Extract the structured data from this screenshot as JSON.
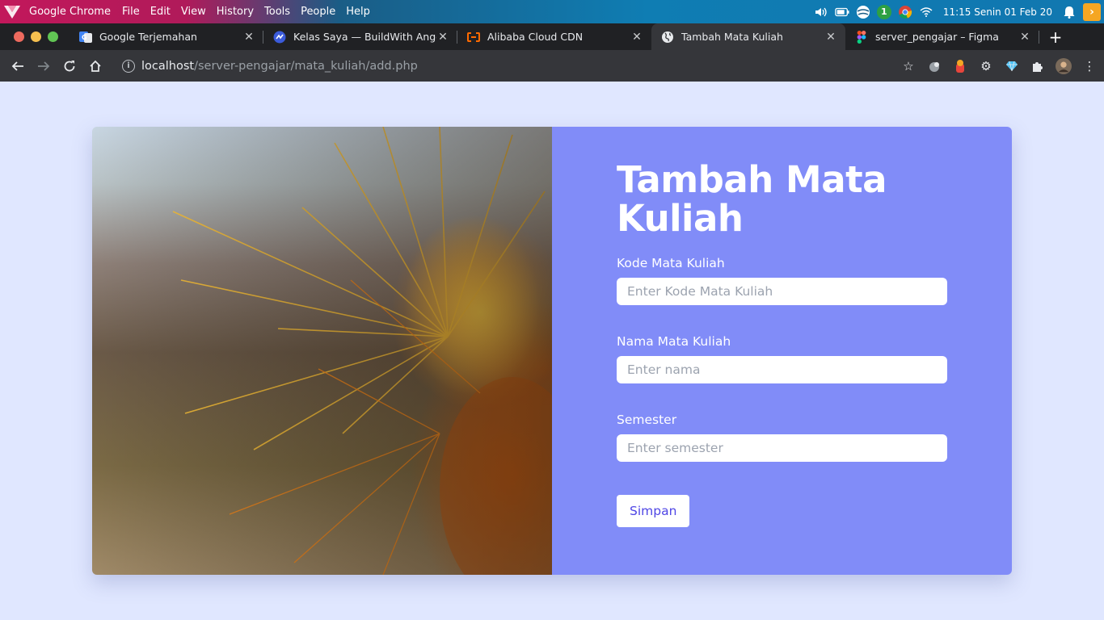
{
  "os": {
    "app_name": "Google Chrome",
    "menus": [
      "File",
      "Edit",
      "View",
      "History",
      "Tools",
      "People",
      "Help"
    ],
    "clock": "11:15 Senin 01 Feb 20",
    "badge_count": "1"
  },
  "tabs": [
    {
      "title": "Google Terjemahan",
      "icon": "google-translate-icon",
      "active": false
    },
    {
      "title": "Kelas Saya — BuildWith Angga",
      "icon": "buildwithangga-icon",
      "active": false
    },
    {
      "title": "Alibaba Cloud CDN",
      "icon": "alibaba-cloud-icon",
      "active": false
    },
    {
      "title": "Tambah Mata Kuliah",
      "icon": "globe-icon",
      "active": true
    },
    {
      "title": "server_pengajar – Figma",
      "icon": "figma-icon",
      "active": false
    }
  ],
  "address": {
    "host": "localhost",
    "path": "/server-pengajar/mata_kuliah/add.php"
  },
  "form": {
    "title": "Tambah Mata Kuliah",
    "fields": [
      {
        "label": "Kode Mata Kuliah",
        "placeholder": "Enter Kode Mata Kuliah",
        "value": ""
      },
      {
        "label": "Nama Mata Kuliah",
        "placeholder": "Enter nama",
        "value": ""
      },
      {
        "label": "Semester",
        "placeholder": "Enter semester",
        "value": ""
      }
    ],
    "submit_label": "Simpan"
  },
  "colors": {
    "page_bg": "#e0e7ff",
    "form_bg": "#818cf8",
    "button_text": "#4f46e5"
  }
}
